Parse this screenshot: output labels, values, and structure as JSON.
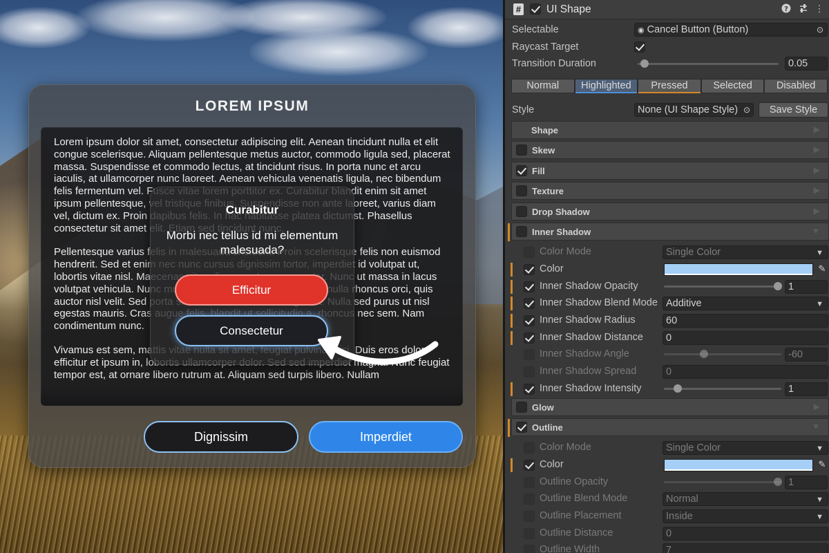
{
  "game": {
    "panel_title": "LOREM IPSUM",
    "paragraphs": [
      "Lorem ipsum dolor sit amet, consectetur adipiscing elit. Aenean tincidunt nulla et elit congue scelerisque. Aliquam pellentesque metus auctor, commodo ligula sed, placerat massa. Suspendisse et commodo lectus, at tincidunt risus. In porta nunc et arcu iaculis, at ullamcorper nunc laoreet. Aenean vehicula venenatis ligula, nec bibendum felis fermentum vel. Fusce vitae lorem porttitor ex. Curabitur blandit enim sit amet ipsum pellentesque, vel tristique finibus. Suspendisse non ante laoreet, varius diam vel, dictum ex. Proin dapibus felis. In hac habitasse platea dictumst. Phasellus consectetur sit amet elit. Etiam sed tincidunt nunc.",
      "Pellentesque varius felis in malesuada tincidunt. Proin scelerisque felis non euismod hendrerit. Sed et enim nec nunc cursus dignissim tortor, imperdiet id volutpat ut, lobortis vitae nisl. Maecenas vitae diam ex at cursus auctor. Nunc ut massa in lacus volutpat vehicula. Nunc mus, velit a placerat tempus, turpis nulla rhoncus orci, quis auctor nisl velit. Sed porta sit sem, eu varius orci feugiat ut. Nulla sed purus ut nisl egestas mauris. Cras augue felis, blandit ut sollicitudin a, rhoncus nec sem. Nam condimentum nunc.",
      "Vivamus est sem, mattis vitae nulla sit amet, feugiat pulvinar nisi. Duis eros dolor, efficitur et ipsum in, lobortis ullamcorper dolor. Sed sed imperdiet magna. Nunc feugiat tempor est, at ornare libero rutrum at. Aliquam sed turpis libero. Nullam"
    ],
    "btn_dignissim": "Dignissim",
    "btn_imperdiet": "Imperdiet",
    "dialog": {
      "title": "Curabitur",
      "message": "Morbi nec tellus id mi elementum malesuada?",
      "btn_efficitur": "Efficitur",
      "btn_consectetur": "Consectetur"
    }
  },
  "inspector": {
    "component_title": "UI Shape",
    "script_icon": "#",
    "help_icon": "help-icon",
    "settings_icon": "settings-sliders-icon",
    "menu_icon": "kebab-menu-icon",
    "selectable_label": "Selectable",
    "selectable_value": "Cancel Button (Button)",
    "raycast_label": "Raycast Target",
    "transition_label": "Transition Duration",
    "transition_value": "0.05",
    "transition_fraction": 0.05,
    "state_tabs": [
      "Normal",
      "Highlighted",
      "Pressed",
      "Selected",
      "Disabled"
    ],
    "style_label": "Style",
    "style_value": "None (UI Shape Style)",
    "save_style": "Save Style",
    "sections_top": [
      {
        "label": "Shape",
        "checkbox": false,
        "checked": false
      },
      {
        "label": "Skew",
        "checkbox": true,
        "checked": false
      },
      {
        "label": "Fill",
        "checkbox": true,
        "checked": true
      },
      {
        "label": "Texture",
        "checkbox": true,
        "checked": false
      },
      {
        "label": "Drop Shadow",
        "checkbox": true,
        "checked": false
      },
      {
        "label": "Inner Shadow",
        "checkbox": true,
        "checked": false
      }
    ],
    "inner_shadow": {
      "color_mode_label": "Color Mode",
      "color_mode_value": "Single Color",
      "color_label": "Color",
      "color_value": "#A6CFF7",
      "opacity_label": "Inner Shadow Opacity",
      "opacity_value": "1",
      "blend_label": "Inner Shadow Blend Mode",
      "blend_value": "Additive",
      "radius_label": "Inner Shadow Radius",
      "radius_value": "60",
      "distance_label": "Inner Shadow Distance",
      "distance_value": "0",
      "angle_label": "Inner Shadow Angle",
      "angle_value": "-60",
      "spread_label": "Inner Shadow Spread",
      "spread_value": "0",
      "intensity_label": "Inner Shadow Intensity",
      "intensity_value": "1"
    },
    "glow_label": "Glow",
    "outline_label": "Outline",
    "outline": {
      "color_mode_label": "Color Mode",
      "color_mode_value": "Single Color",
      "color_label": "Color",
      "color_value": "#A6CFF7",
      "opacity_label": "Outline Opacity",
      "opacity_value": "1",
      "blend_label": "Outline Blend Mode",
      "blend_value": "Normal",
      "placement_label": "Outline Placement",
      "placement_value": "Inside",
      "distance_label": "Outline Distance",
      "distance_value": "0",
      "width_label": "Outline Width",
      "width_value": "7"
    },
    "colors": {
      "changed_marker": "#D28A2B",
      "highlighted_bar": "#4A90D9",
      "pressed_bar": "#D28A2B"
    }
  }
}
